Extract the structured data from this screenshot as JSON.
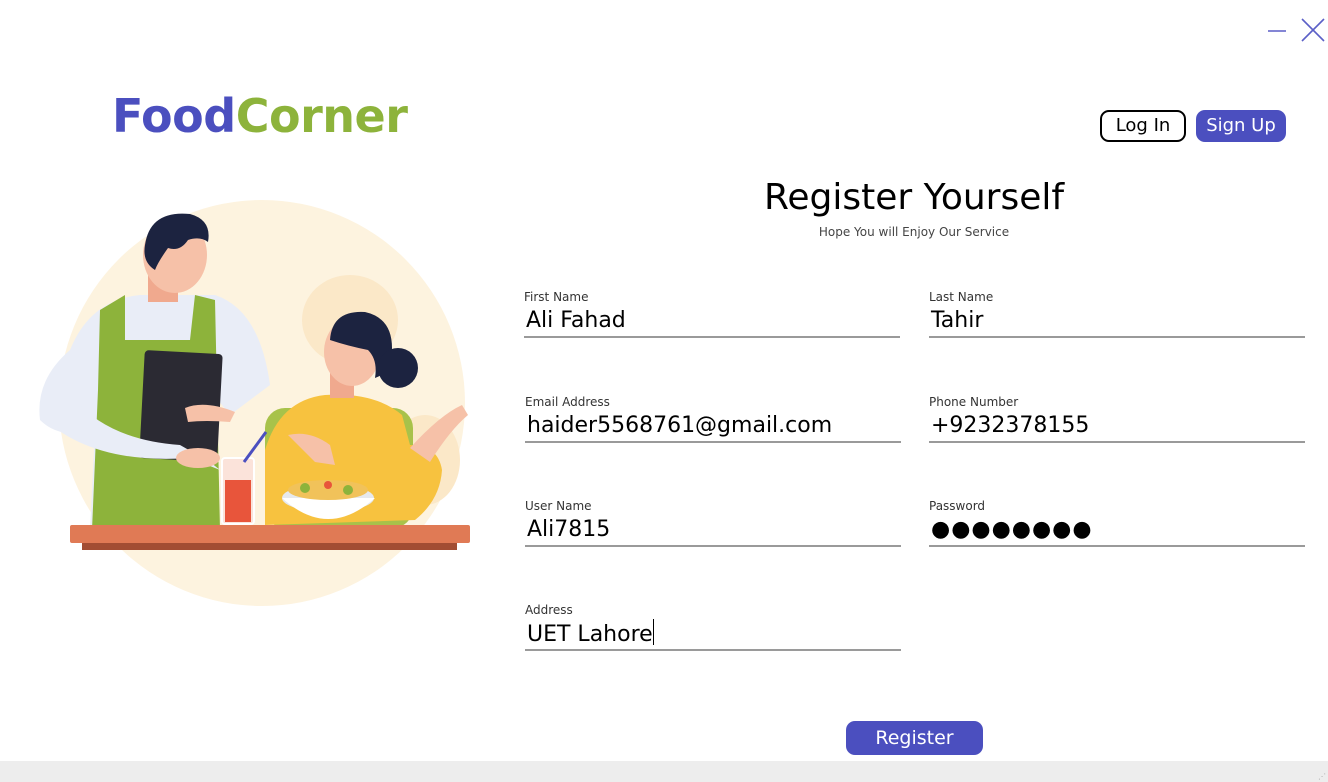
{
  "window": {
    "minimize_icon": "minimize-icon",
    "close_icon": "close-icon"
  },
  "logo": {
    "part1": "Food",
    "part2": "Corner",
    "color1": "#4b4fbf",
    "color2": "#8db33b"
  },
  "nav": {
    "login_label": "Log In",
    "signup_label": "Sign Up"
  },
  "form": {
    "title": "Register Yourself",
    "subtitle": "Hope You will Enjoy Our Service",
    "first_name": {
      "label": "First Name",
      "value": "Ali Fahad"
    },
    "last_name": {
      "label": "Last Name",
      "value": "Tahir"
    },
    "email": {
      "label": "Email Address",
      "value": "haider5568761@gmail.com"
    },
    "phone": {
      "label": "Phone Number",
      "value": "+9232378155"
    },
    "username": {
      "label": "User Name",
      "value": "Ali7815"
    },
    "password": {
      "label": "Password",
      "value": "●●●●●●●●"
    },
    "address": {
      "label": "Address",
      "value": "UET Lahore"
    },
    "register_label": "Register"
  },
  "colors": {
    "accent": "#4b4fbf",
    "brand_green": "#8db33b",
    "underline": "#9a9a9a"
  }
}
